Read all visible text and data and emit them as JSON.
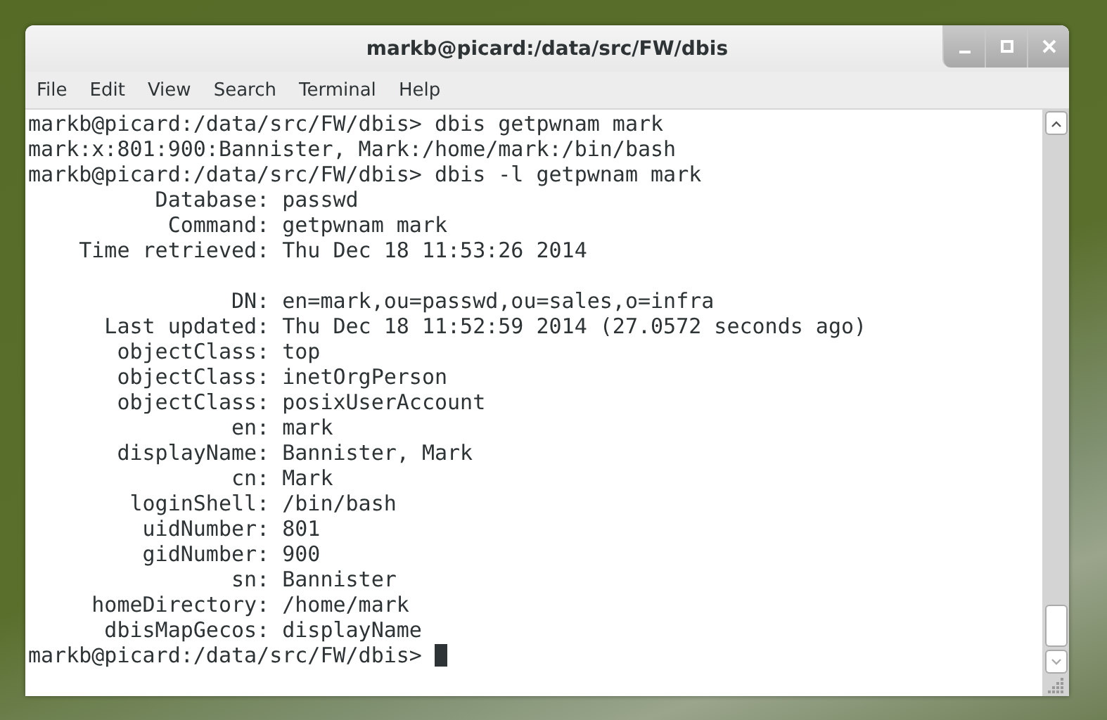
{
  "window": {
    "title": "markb@picard:/data/src/FW/dbis"
  },
  "menu": [
    "File",
    "Edit",
    "View",
    "Search",
    "Terminal",
    "Help"
  ],
  "terminal": {
    "lines": [
      {
        "kind": "text",
        "text": "markb@picard:/data/src/FW/dbis> dbis getpwnam mark"
      },
      {
        "kind": "text",
        "text": "mark:x:801:900:Bannister, Mark:/home/mark:/bin/bash"
      },
      {
        "kind": "text",
        "text": "markb@picard:/data/src/FW/dbis> dbis -l getpwnam mark"
      },
      {
        "kind": "text",
        "text": "          Database: passwd"
      },
      {
        "kind": "text",
        "text": "           Command: getpwnam mark"
      },
      {
        "kind": "text",
        "text": "    Time retrieved: Thu Dec 18 11:53:26 2014"
      },
      {
        "kind": "blank"
      },
      {
        "kind": "text",
        "text": "                DN: en=mark,ou=passwd,ou=sales,o=infra"
      },
      {
        "kind": "text",
        "text": "      Last updated: Thu Dec 18 11:52:59 2014 (27.0572 seconds ago)"
      },
      {
        "kind": "text",
        "text": "       objectClass: top"
      },
      {
        "kind": "text",
        "text": "       objectClass: inetOrgPerson"
      },
      {
        "kind": "text",
        "text": "       objectClass: posixUserAccount"
      },
      {
        "kind": "text",
        "text": "                en: mark"
      },
      {
        "kind": "text",
        "text": "       displayName: Bannister, Mark"
      },
      {
        "kind": "text",
        "text": "                cn: Mark"
      },
      {
        "kind": "text",
        "text": "        loginShell: /bin/bash"
      },
      {
        "kind": "text",
        "text": "         uidNumber: 801"
      },
      {
        "kind": "text",
        "text": "         gidNumber: 900"
      },
      {
        "kind": "text",
        "text": "                sn: Bannister"
      },
      {
        "kind": "text",
        "text": "     homeDirectory: /home/mark"
      },
      {
        "kind": "text",
        "text": "      dbisMapGecos: displayName"
      },
      {
        "kind": "prompt",
        "text": "markb@picard:/data/src/FW/dbis> "
      }
    ]
  }
}
